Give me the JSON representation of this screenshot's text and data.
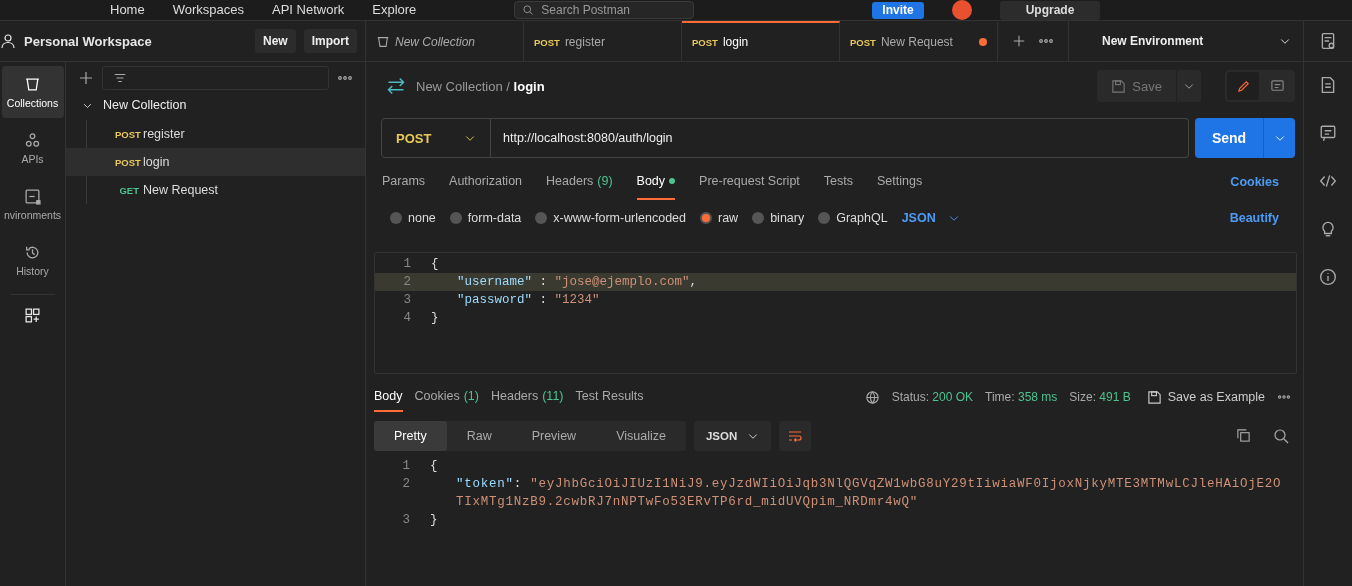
{
  "top_bar": {
    "nav": [
      "Home",
      "Workspaces",
      "API Network",
      "Explore"
    ],
    "search": {
      "placeholder": "Search Postman"
    },
    "invite": "Invite",
    "upgrade": "Upgrade"
  },
  "workspace": {
    "name": "Personal Workspace",
    "buttons": [
      "New",
      "Import"
    ]
  },
  "rail": [
    {
      "label": "Collections",
      "selected": true
    },
    {
      "label": "APIs",
      "selected": false
    },
    {
      "label": "nvironments",
      "selected": false
    },
    {
      "label": "History",
      "selected": false
    }
  ],
  "tree": {
    "name": "New Collection",
    "expanded": true,
    "children": [
      {
        "method": "POST",
        "color": "#e8c95a",
        "label": "register",
        "selected": false
      },
      {
        "method": "POST",
        "color": "#e8c95a",
        "label": "login",
        "selected": true
      },
      {
        "method": "GET",
        "color": "#4ec38f",
        "label": "New Request",
        "selected": false
      }
    ]
  },
  "tabs": [
    {
      "kind": "collection",
      "label": "New Collection",
      "selected": false,
      "unsaved": false
    },
    {
      "kind": "request",
      "method": "POST",
      "color": "#e8c95a",
      "label": "register",
      "selected": false,
      "unsaved": false
    },
    {
      "kind": "request",
      "method": "POST",
      "color": "#e8c95a",
      "label": "login",
      "selected": true,
      "unsaved": false
    },
    {
      "kind": "request",
      "method": "POST",
      "color": "#e8c95a",
      "label": "New Request",
      "selected": false,
      "unsaved": true
    }
  ],
  "environment": "New Environment",
  "breadcrumb": {
    "collection": "New Collection",
    "separator": "/",
    "request": "login"
  },
  "save": "Save",
  "request": {
    "method": "POST",
    "url": "http://localhost:8080/auth/login",
    "send": "Send"
  },
  "request_tabs": [
    {
      "label": "Params",
      "selected": false
    },
    {
      "label": "Authorization",
      "selected": false
    },
    {
      "label": "Headers",
      "count": "(9)",
      "selected": false
    },
    {
      "label": "Body",
      "dot": true,
      "selected": true
    },
    {
      "label": "Pre-request Script",
      "selected": false
    },
    {
      "label": "Tests",
      "selected": false
    },
    {
      "label": "Settings",
      "selected": false
    }
  ],
  "cookies_link": "Cookies",
  "body_types": [
    {
      "label": "none",
      "selected": false
    },
    {
      "label": "form-data",
      "selected": false
    },
    {
      "label": "x-www-form-urlencoded",
      "selected": false
    },
    {
      "label": "raw",
      "selected": true
    },
    {
      "label": "binary",
      "selected": false
    },
    {
      "label": "GraphQL",
      "selected": false
    }
  ],
  "body_format": "JSON",
  "beautify": "Beautify",
  "body_lines": [
    {
      "num": "1",
      "current": false,
      "tokens": [
        {
          "kind": "punct",
          "text": "{"
        }
      ]
    },
    {
      "num": "2",
      "current": true,
      "tokens": [
        {
          "kind": "key",
          "text": "\"username\""
        },
        {
          "kind": "punct",
          "text": " : "
        },
        {
          "kind": "string",
          "text": "\"jose@ejemplo.com\""
        },
        {
          "kind": "punct",
          "text": ","
        }
      ]
    },
    {
      "num": "3",
      "current": false,
      "tokens": [
        {
          "kind": "key",
          "text": "\"password\""
        },
        {
          "kind": "punct",
          "text": " : "
        },
        {
          "kind": "string",
          "text": "\"1234\""
        }
      ]
    },
    {
      "num": "4",
      "current": false,
      "tokens": [
        {
          "kind": "punct",
          "text": "}"
        }
      ]
    }
  ],
  "response_tabs": [
    {
      "label": "Body",
      "selected": true
    },
    {
      "label": "Cookies",
      "count": "(1)",
      "selected": false
    },
    {
      "label": "Headers",
      "count": "(11)",
      "selected": false
    },
    {
      "label": "Test Results",
      "selected": false
    }
  ],
  "status": [
    {
      "label": "Status:",
      "value": "200 OK"
    },
    {
      "label": "Time:",
      "value": "358 ms"
    },
    {
      "label": "Size:",
      "value": "491 B"
    }
  ],
  "save_example": "Save as Example",
  "views": [
    {
      "label": "Pretty",
      "selected": true
    },
    {
      "label": "Raw",
      "selected": false
    },
    {
      "label": "Preview",
      "selected": false
    },
    {
      "label": "Visualize",
      "selected": false
    }
  ],
  "response_format": "JSON",
  "response_lines": [
    {
      "num": "1",
      "tokens": [
        {
          "kind": "punct",
          "text": "{"
        }
      ]
    },
    {
      "num": "2",
      "tokens": [
        {
          "kind": "key",
          "text": "\"token\""
        },
        {
          "kind": "punct",
          "text": ": "
        },
        {
          "kind": "string",
          "text": "\"eyJhbGciOiJIUzI1NiJ9.eyJzdWIiOiJqb3NlQGVqZW1wbG8uY29tIiwiaWF0IjoxNjkyMTE3MTMwLCJleHAiOjE2OTIxMTg1NzB9.2cwbRJ7nNPTwFo53ERvTP6rd_midUVQpim_NRDmr4wQ\""
        }
      ]
    },
    {
      "num": "3",
      "tokens": [
        {
          "kind": "punct",
          "text": "}"
        }
      ]
    }
  ]
}
